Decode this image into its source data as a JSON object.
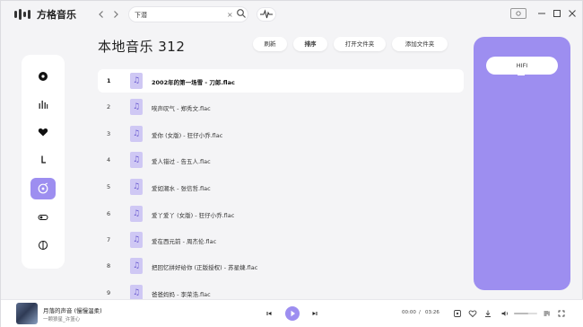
{
  "app": {
    "name": "方格音乐",
    "brand_color": "#9d8ef0"
  },
  "search": {
    "value": "下潜",
    "clear_glyph": "×"
  },
  "main": {
    "title": "本地音乐 312",
    "actions": [
      {
        "label": "刷新"
      },
      {
        "label": "排序"
      },
      {
        "label": "打开文件夹"
      },
      {
        "label": "添加文件夹"
      }
    ]
  },
  "tracks": [
    {
      "num": "1",
      "name": "2002年的第一场雪 - 刀郎.flac"
    },
    {
      "num": "2",
      "name": "唉声叹气 - 郑秀文.flac"
    },
    {
      "num": "3",
      "name": "爱你 (女版) - 狂仔小乔.flac"
    },
    {
      "num": "4",
      "name": "爱人错过 - 告五人.flac"
    },
    {
      "num": "5",
      "name": "爱如潮水 - 张信哲.flac"
    },
    {
      "num": "6",
      "name": "爱丫爱丫 (女版) - 狂仔小乔.flac"
    },
    {
      "num": "7",
      "name": "爱在西元前 - 周杰伦.flac"
    },
    {
      "num": "8",
      "name": "把回忆拼好给你 (正版授权) - 苏星婕.flac"
    },
    {
      "num": "9",
      "name": "爸爸妈妈 - 李荣浩.flac"
    }
  ],
  "panel": {
    "mode_label": "HIFI"
  },
  "player": {
    "title": "月落的声音 (慢慢温柔)",
    "artist": "一颗狼星_许篮心",
    "current_time": "00:00",
    "separator": "/",
    "total_time": "03:26",
    "volume": 0.6
  }
}
